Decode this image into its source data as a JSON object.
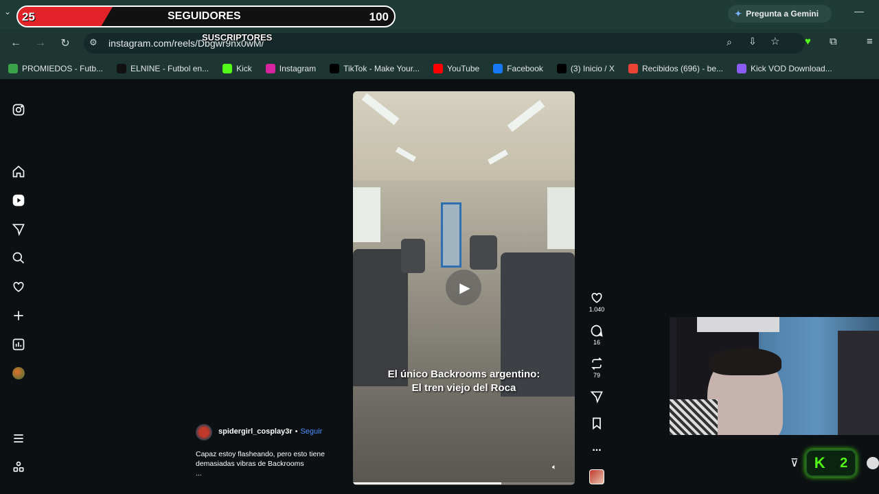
{
  "overlay": {
    "left_count": "25",
    "label": "SEGUIDORES",
    "right_count": "100",
    "sub_label": "SUSCRIPTORES"
  },
  "browser": {
    "url": "instagram.com/reels/Dbgwr9nx0wM/",
    "gemini_label": "Pregunta a Gemini",
    "bookmarks": [
      {
        "label": "PROMIEDOS - Futb...",
        "icon": "promiedos-icon",
        "color": "#3aa34a"
      },
      {
        "label": "ELNINE - Futbol en...",
        "icon": "elnine-icon",
        "color": "#111111"
      },
      {
        "label": "Kick",
        "icon": "kick-icon",
        "color": "#53fc18"
      },
      {
        "label": "Instagram",
        "icon": "instagram-icon",
        "color": "#d6249f"
      },
      {
        "label": "TikTok - Make Your...",
        "icon": "tiktok-icon",
        "color": "#000000"
      },
      {
        "label": "YouTube",
        "icon": "youtube-icon",
        "color": "#ff0000"
      },
      {
        "label": "Facebook",
        "icon": "facebook-icon",
        "color": "#1877f2"
      },
      {
        "label": "(3) Inicio / X",
        "icon": "x-icon",
        "color": "#000000"
      },
      {
        "label": "Recibidos (696) - be...",
        "icon": "gmail-icon",
        "color": "#ea4335"
      },
      {
        "label": "Kick VOD Download...",
        "icon": "kickvod-icon",
        "color": "#8a5cf6"
      }
    ]
  },
  "reel": {
    "caption_line1": "El único Backrooms argentino:",
    "caption_line2": "El tren viejo del Roca",
    "username": "spidergirl_cosplay3r",
    "separator": "•",
    "follow": "Seguir",
    "description_line1": "Capaz estoy flasheando, pero esto tiene",
    "description_line2": "demasiadas vibras de Backrooms",
    "more": "...",
    "likes": "1.040",
    "comments": "16",
    "reposts": "79",
    "more_options": "...",
    "progress": 0.67
  },
  "kick_widget": {
    "count": "2"
  },
  "colors": {
    "accent_red": "#e2232a",
    "kick_green": "#53fc18",
    "follow_blue": "#4a90ff"
  }
}
